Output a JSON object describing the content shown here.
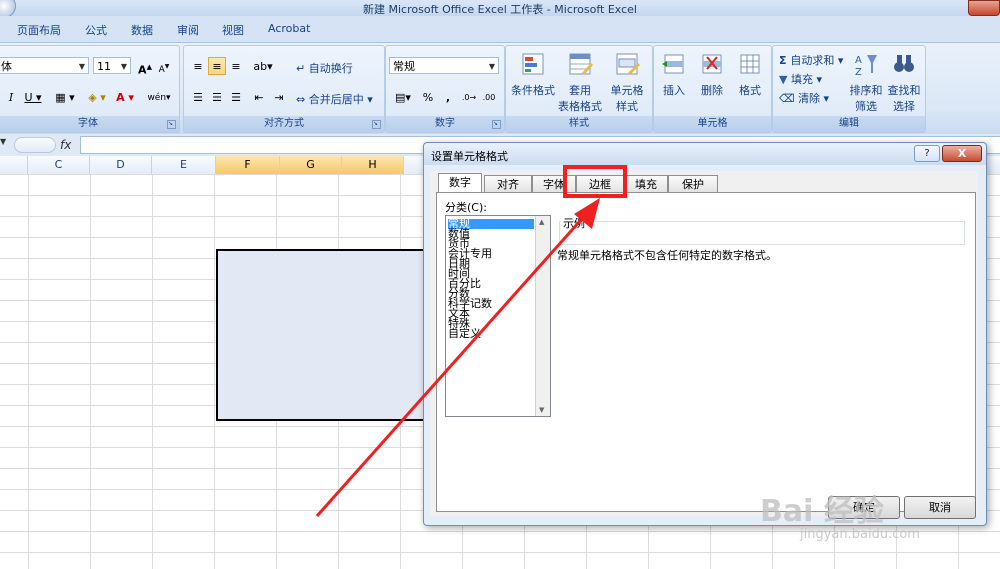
{
  "window": {
    "title": "新建 Microsoft Office Excel 工作表 - Microsoft Excel"
  },
  "tabs": [
    "页面布局",
    "公式",
    "数据",
    "审阅",
    "视图",
    "Acrobat"
  ],
  "ribbon": {
    "font": {
      "name_partial": "体",
      "size": "11",
      "group_label": "字体"
    },
    "align": {
      "wrap": "自动换行",
      "merge": "合并后居中",
      "group_label": "对齐方式"
    },
    "number": {
      "format": "常规",
      "percent": "%",
      "comma": ",",
      "group_label": "数字"
    },
    "styles": {
      "cond": "条件格式",
      "table1": "套用",
      "table2": "表格格式",
      "cell1": "单元格",
      "cell2": "样式",
      "group_label": "样式"
    },
    "cells": {
      "insert": "插入",
      "delete": "删除",
      "format": "格式",
      "group_label": "单元格"
    },
    "edit": {
      "autosum": "自动求和",
      "fill": "填充",
      "clear": "清除",
      "sort1": "排序和",
      "sort2": "筛选",
      "find1": "查找和",
      "find2": "选择",
      "group_label": "编辑"
    }
  },
  "formula": {
    "fx": "fx"
  },
  "columns": [
    {
      "label": "C",
      "selected": false
    },
    {
      "label": "D",
      "selected": false
    },
    {
      "label": "E",
      "selected": false
    },
    {
      "label": "F",
      "selected": true
    },
    {
      "label": "G",
      "selected": true
    },
    {
      "label": "H",
      "selected": true
    }
  ],
  "dialog": {
    "title": "设置单元格格式",
    "help": "?",
    "close": "X",
    "tabs": [
      "数字",
      "对齐",
      "字体",
      "边框",
      "填充",
      "保护"
    ],
    "active_tab": "数字",
    "category_label": "分类(C):",
    "categories": [
      "常规",
      "数值",
      "货币",
      "会计专用",
      "日期",
      "时间",
      "百分比",
      "分数",
      "科学记数",
      "文本",
      "特殊",
      "自定义"
    ],
    "selected_category": "常规",
    "sample_label": "示例",
    "description": "常规单元格格式不包含任何特定的数字格式。",
    "ok": "确定",
    "cancel": "取消"
  },
  "annotation": {
    "color": "#f02020"
  },
  "watermark": {
    "text": "Bai 经验",
    "url": "jingyan.baidu.com"
  }
}
